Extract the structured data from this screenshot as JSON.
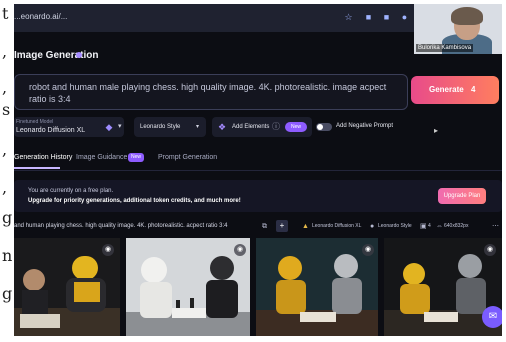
{
  "side_text": [
    "t",
    ",",
    ",",
    "s",
    ",",
    ",",
    "g",
    "n",
    "g"
  ],
  "browser": {
    "url": "...eonardo.ai/..."
  },
  "webcam": {
    "name": "Bulorika Kambisova"
  },
  "page": {
    "title": "Image Generation"
  },
  "prompt": {
    "text": "robot and human male playing chess. high quality image. 4K. photorealistic. image acpect ratio is 3:4"
  },
  "generate": {
    "label": "Generate",
    "cost": "4"
  },
  "controls": {
    "model_label": "Finetuned Model",
    "model_value": "Leonardo Diffusion XL",
    "style_value": "Leonardo Style",
    "elements_label": "Add Elements",
    "elements_badge": "New",
    "negative_prompt_label": "Add Negative Prompt"
  },
  "tabs": [
    {
      "label": "Generation History",
      "active": true
    },
    {
      "label": "Image Guidance",
      "badge": "New"
    },
    {
      "label": "Prompt Generation"
    }
  ],
  "banner": {
    "line1": "You are currently on a free plan.",
    "line2": "Upgrade for priority generations, additional token credits, and much more!",
    "button": "Upgrade Plan"
  },
  "generation": {
    "prompt": "and human playing chess. high quality image. 4K. photorealistic. acpect ratio 3:4",
    "model_tag": "Leonardo Diffusion XL",
    "style_tag": "Leonardo Style",
    "count_tag": "4",
    "size_tag": "640x832px"
  },
  "colors": {
    "accent": "#8e5cff",
    "generate_gradient_start": "#e84b8a",
    "generate_gradient_end": "#ff7e5f",
    "background": "#0c0d13"
  }
}
